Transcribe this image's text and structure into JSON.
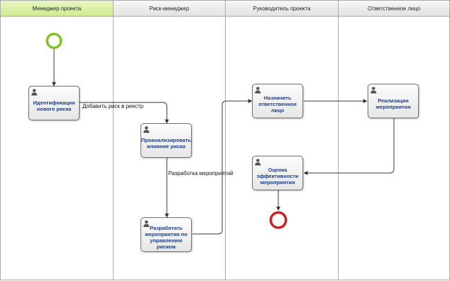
{
  "diagram": {
    "lanes": [
      {
        "title": "Менеджер проекта",
        "highlighted": true
      },
      {
        "title": "Риск-менеджер",
        "highlighted": false
      },
      {
        "title": "Руководитель проекта",
        "highlighted": false
      },
      {
        "title": "Ответственное лицо",
        "highlighted": false
      }
    ],
    "tasks": {
      "identify": {
        "label": "Идентификация нового риска",
        "icon": "user-icon"
      },
      "analyze": {
        "label": "Проанализировать влияние риска",
        "icon": "user-icon"
      },
      "develop": {
        "label": "Разработать мероприятия по управлению риском",
        "icon": "user-icon"
      },
      "assign": {
        "label": "Назначить ответственное лицо",
        "icon": "user-icon"
      },
      "implement": {
        "label": "Реализация мероприятия",
        "icon": "user-icon"
      },
      "evaluate": {
        "label": "Оценка эффективности мероприятия",
        "icon": "user-icon"
      }
    },
    "flow_labels": {
      "add_to_registry": "Добавить риск в реестр",
      "develop_actions": "Разработка мероприятий"
    },
    "events": {
      "start": {
        "type": "start-event",
        "color": "#7dc31e"
      },
      "end": {
        "type": "end-event",
        "color": "#cc1f1f"
      }
    },
    "colors": {
      "task_text": "#1c3f8c",
      "active_lane_header": "#d0eb91",
      "connector": "#333333"
    }
  }
}
